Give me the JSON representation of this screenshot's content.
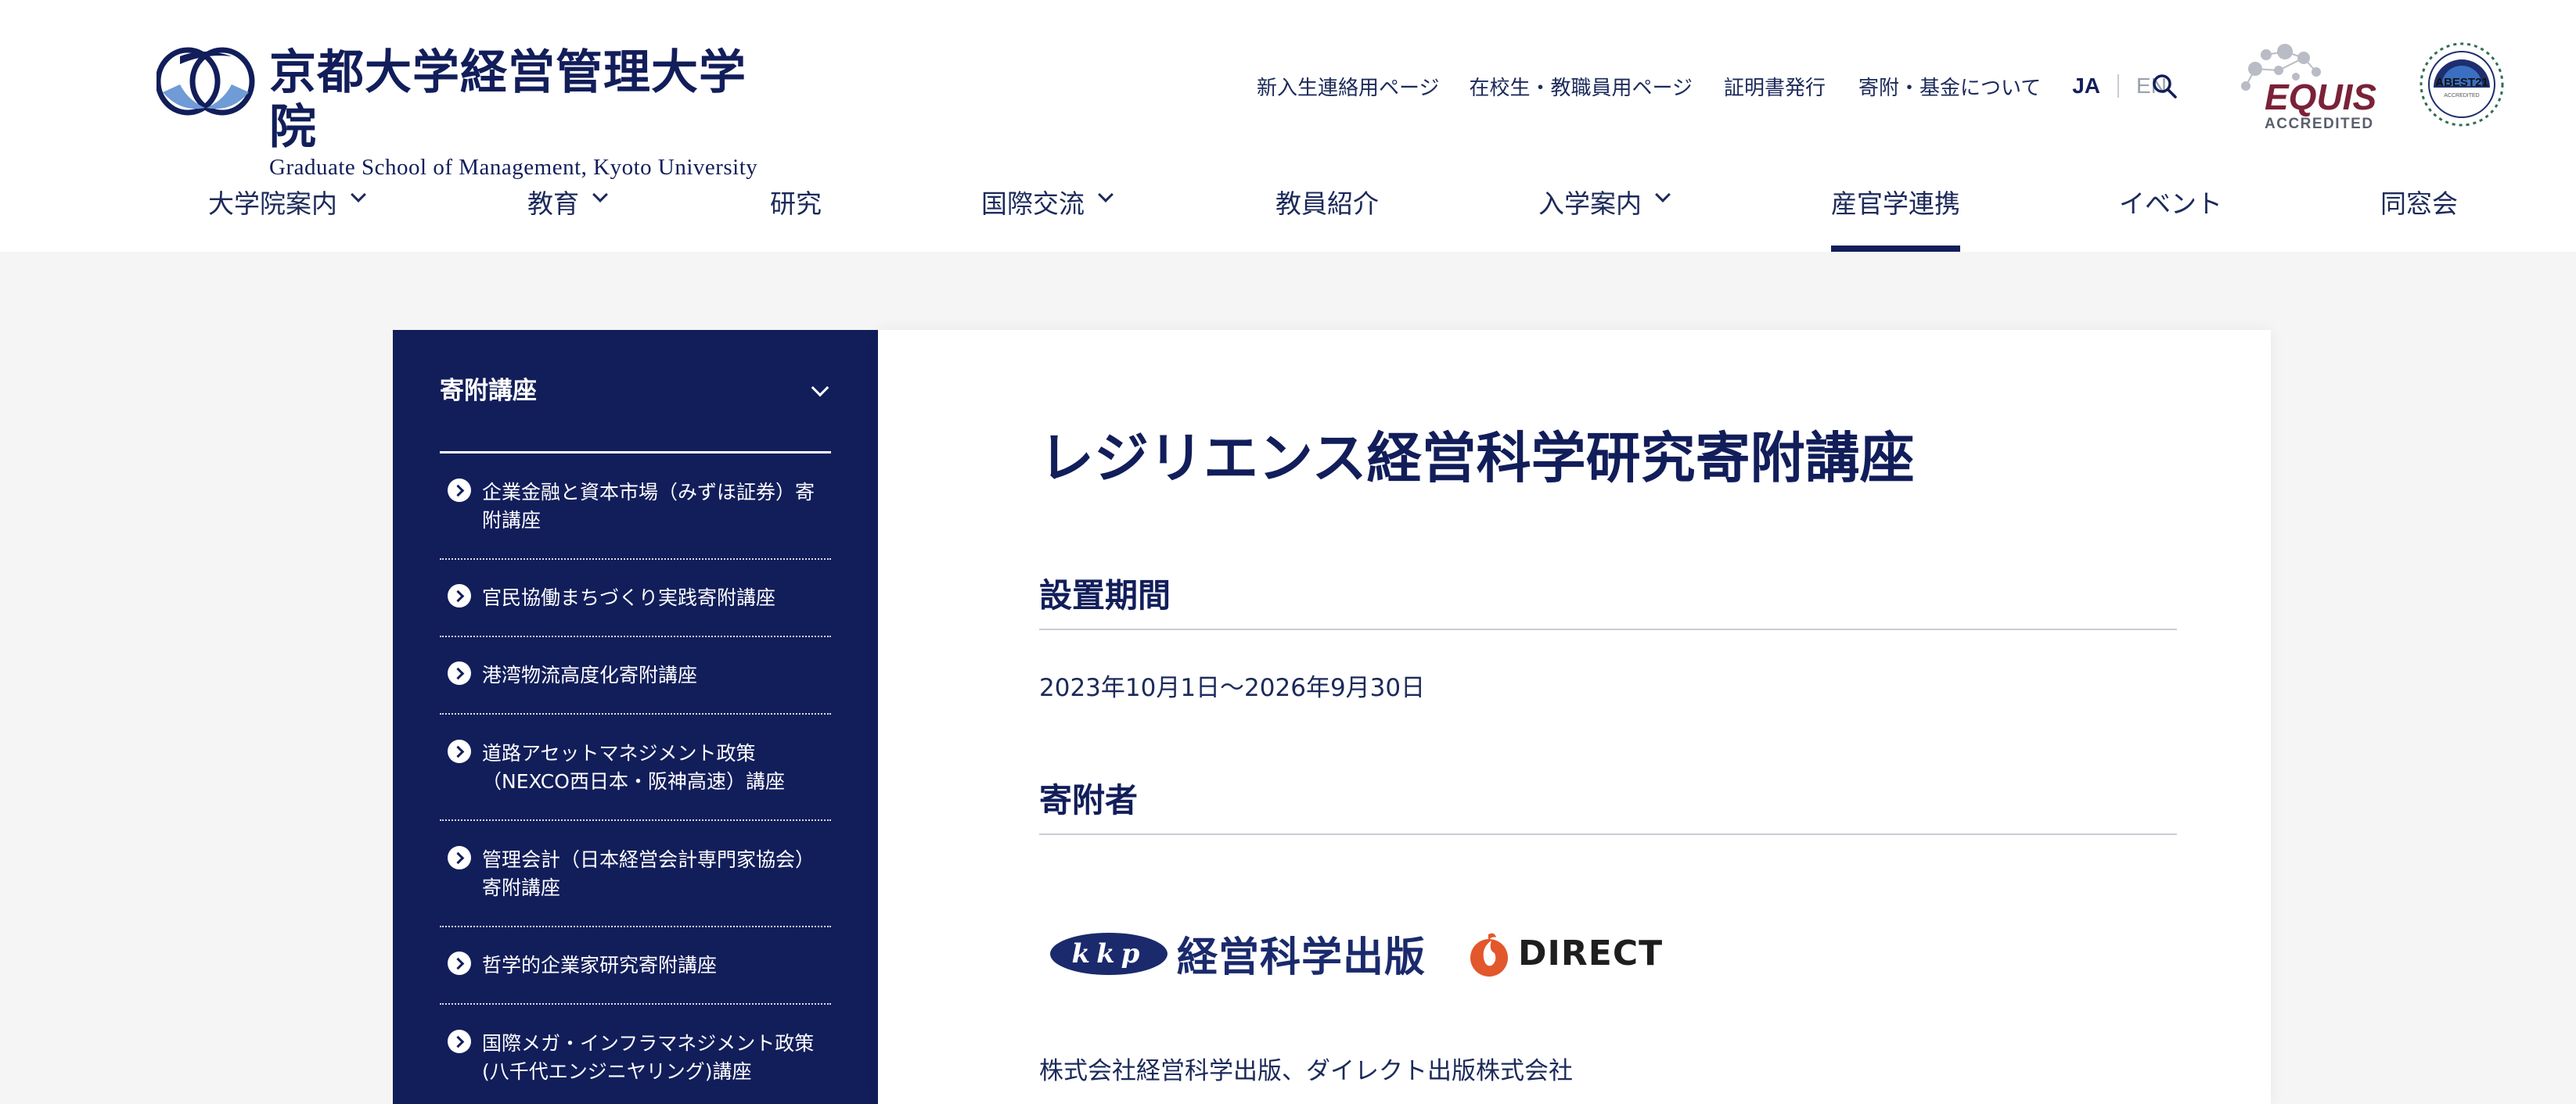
{
  "header": {
    "logo_jp": "京都大学経営管理大学院",
    "logo_en": "Graduate School of Management, Kyoto University",
    "util_links": [
      "新入生連絡用ページ",
      "在校生・教職員用ページ",
      "証明書発行",
      "寄附・基金について"
    ],
    "lang_ja": "JA",
    "lang_en": "EN",
    "equis_name": "EQUIS",
    "equis_sub": "ACCREDITED",
    "abest_name": "ABEST21",
    "abest_sub": "ACCREDITED"
  },
  "nav": {
    "items": [
      {
        "label": "大学院案内",
        "has_dropdown": true
      },
      {
        "label": "教育",
        "has_dropdown": true
      },
      {
        "label": "研究",
        "has_dropdown": false
      },
      {
        "label": "国際交流",
        "has_dropdown": true
      },
      {
        "label": "教員紹介",
        "has_dropdown": false
      },
      {
        "label": "入学案内",
        "has_dropdown": true
      },
      {
        "label": "産官学連携",
        "has_dropdown": false,
        "active": true
      },
      {
        "label": "イベント",
        "has_dropdown": false
      },
      {
        "label": "同窓会",
        "has_dropdown": false
      }
    ]
  },
  "sidebar": {
    "title": "寄附講座",
    "items": [
      {
        "label": "企業金融と資本市場（みずほ証券）寄附講座"
      },
      {
        "label": "官民協働まちづくり実践寄附講座"
      },
      {
        "label": "港湾物流高度化寄附講座"
      },
      {
        "label": "道路アセットマネジメント政策（NEXCO西日本・阪神高速）講座"
      },
      {
        "label": "管理会計（日本経営会計専門家協会）寄附講座"
      },
      {
        "label": "哲学的企業家研究寄附講座"
      },
      {
        "label": "国際メガ・インフラマネジメント政策(八千代エンジニヤリング)講座"
      }
    ]
  },
  "main": {
    "title": "レジリエンス経営科学研究寄附講座",
    "section1_heading": "設置期間",
    "period": "2023年10月1日〜2026年9月30日",
    "section2_heading": "寄附者",
    "logo1_mark": "kkp",
    "logo1_text": "経営科学出版",
    "logo2_text": "DIRECT",
    "sponsor_names": "株式会社経営科学出版、ダイレクト出版株式会社"
  },
  "colors": {
    "navy": "#121e5a",
    "background": "#f5f5f5",
    "equis": "#7a2238",
    "direct_orange": "#e2572b"
  }
}
